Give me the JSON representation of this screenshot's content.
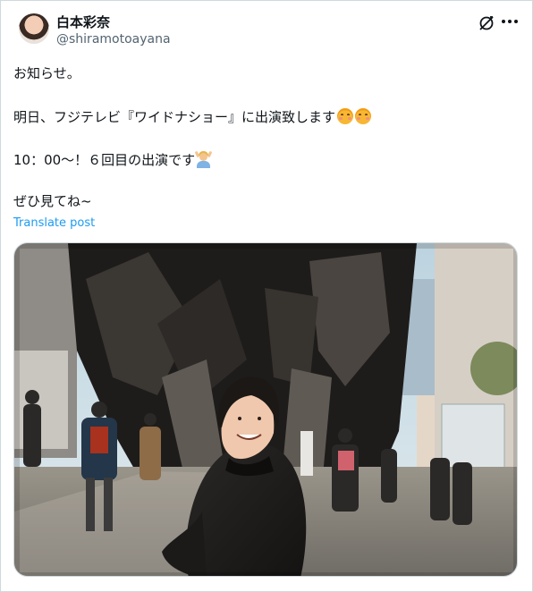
{
  "author": {
    "display_name": "白本彩奈",
    "handle": "@shiramotoayana",
    "avatar_icon": "profile-photo"
  },
  "header_icons": [
    "grok-icon",
    "more-icon"
  ],
  "post": {
    "line1": "お知らせ。",
    "line2": "明日、フジテレビ『ワイドナショー』に出演致します",
    "line2_emojis": [
      "smiling-face-icon",
      "smiling-face-icon"
    ],
    "line3": "10：00〜！６回目の出演です",
    "line3_emoji": "person-raising-hand-icon",
    "line4": "ぜひ見てね~",
    "translate": "Translate post"
  },
  "media": {
    "type": "photo",
    "icon": "film-photo-street-portrait"
  },
  "colors": {
    "text": "#0f1419",
    "secondary": "#536471",
    "link": "#1d9bf0",
    "border": "#cfd9de"
  }
}
